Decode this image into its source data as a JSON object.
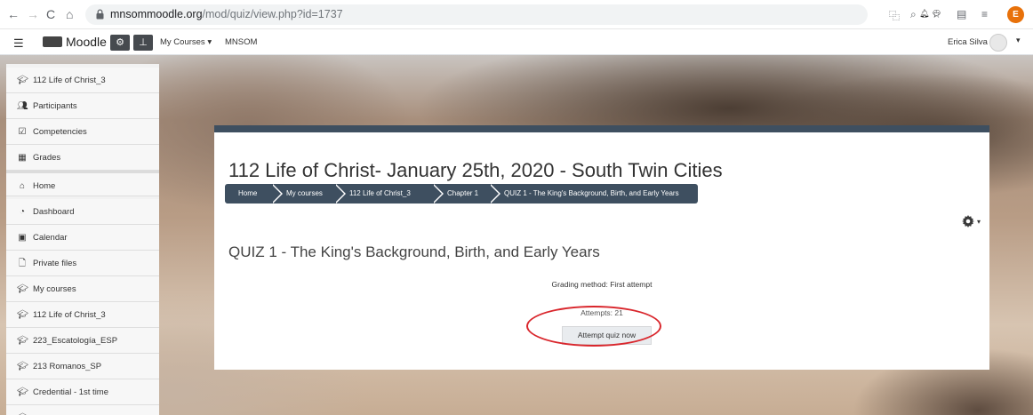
{
  "browser": {
    "url_domain": "mnsommoodle.org",
    "url_path": "/mod/quiz/view.php?id=1737",
    "profile_initial": "E"
  },
  "navbar": {
    "brand": "Moodle",
    "my_courses": "My Courses",
    "site": "MNSOM",
    "user_name": "Erica Silva"
  },
  "sidebar": {
    "items": [
      {
        "label": "112 Life of Christ_3",
        "icon": "graduation-cap-icon"
      },
      {
        "label": "Participants",
        "icon": "users-icon"
      },
      {
        "label": "Competencies",
        "icon": "checkbox-icon"
      },
      {
        "label": "Grades",
        "icon": "table-icon"
      },
      {
        "label": "Home",
        "icon": "home-icon"
      },
      {
        "label": "Dashboard",
        "icon": "dashboard-icon"
      },
      {
        "label": "Calendar",
        "icon": "calendar-icon"
      },
      {
        "label": "Private files",
        "icon": "file-icon"
      },
      {
        "label": "My courses",
        "icon": "graduation-cap-icon"
      },
      {
        "label": "112 Life of Christ_3",
        "icon": "graduation-cap-icon"
      },
      {
        "label": "223_Escatología_ESP",
        "icon": "graduation-cap-icon"
      },
      {
        "label": "213 Romanos_SP",
        "icon": "graduation-cap-icon"
      },
      {
        "label": "Credential - 1st time",
        "icon": "graduation-cap-icon"
      }
    ]
  },
  "main": {
    "page_title": "112 Life of Christ- January 25th, 2020 - South Twin Cities",
    "breadcrumbs": [
      "Home",
      "My courses",
      "112 Life of Christ_3",
      "Chapter 1",
      "QUIZ 1 - The King's Background, Birth, and Early Years"
    ],
    "quiz_title": "QUIZ 1 - The King's Background, Birth, and Early Years",
    "grading_method": "Grading method: First attempt",
    "attempts": "Attempts: 21",
    "attempt_button": "Attempt quiz now"
  },
  "colors": {
    "header_bar": "#3e4f60",
    "annotation": "#d9262c"
  }
}
